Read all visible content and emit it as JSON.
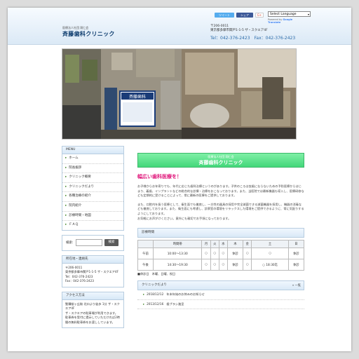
{
  "header": {
    "tagline": "医療法人社団 翔仁会",
    "title": "斉藤歯科クリニック",
    "social": {
      "twitter": "ツイート",
      "facebook": "シェア",
      "gplus": "G+"
    },
    "language": {
      "selected": "Select Language",
      "powered_prefix": "Powered by",
      "powered_brand": "Google Translate"
    },
    "postal": "〒206-0011",
    "address": "東京都多摩市関戸1-1-5 ザ・スクエア4F",
    "tel_line": "Tel：042-376-2423　Fax：042-376-2423"
  },
  "sidebar": {
    "menu_title": "MENU",
    "menu_items": [
      "ホーム",
      "院長挨拶",
      "クリニック概要",
      "クリニックだより",
      "各種治療の紹介",
      "院内紹介",
      "診療時間・地図",
      "ＦＡＱ"
    ],
    "search_label": "検索:",
    "search_button": "検索",
    "location_title": "所在地・連絡先",
    "location_lines": [
      "〒206-0011",
      "東京都多摩市関戸1-1-5 ザ・スクエア4F",
      "Tel：042-376-2423",
      "Fax：042-376-2423"
    ],
    "access_title": "アクセス方法",
    "access_lines": [
      "聖蹟桜ヶ丘駅 北口より徒歩 1分 ザ・スクエア4F",
      "ザ・スクエアの駐車場が利用できます。",
      "駐車券を受付に提示していただければ2時間の無料駐車券をお渡ししています。"
    ]
  },
  "main": {
    "banner_small": "医療法人社団 翔仁会",
    "banner_large": "斉藤歯科クリニック",
    "lead": "幅広い歯科医療を！",
    "para1": "お子様からお年寄りでも、年代に応じた歯科治療というのがあります。子供のころは虫歯にならないための予防医療からはじまり、義歯、インプラントなどの総合的な診療・治療をおこなっております。また、当医院では最新機器も導入し、医療研修なども定期的に受けることによって、常に最新の医療をご提供しております。",
    "para2": "また、口腔内を扱う医療として、衛生面でも徹底し、一方性の器具の採用や完全滅菌できる滅菌機器を採用し、機器の消毒なども徹底しております。また、衛生面にも考慮し、診察室の環境をリラックスした環境をご提供できるように、常に気配りするようにしております。",
    "para3": "お気軽にお声がけください。意外にも親切でお手頃になっております。",
    "hours_title": "診療時間",
    "hours_head": [
      "時間帯",
      "月",
      "火",
      "水",
      "木",
      "金",
      "土",
      "日"
    ],
    "hours_rows": [
      [
        "午前",
        "10:00〜13:30",
        "○",
        "○",
        "○",
        "休診",
        "○",
        "○",
        "休診"
      ],
      [
        "午後",
        "14:30〜19:30",
        "○",
        "○",
        "○",
        "休診",
        "○",
        "○ 18:30迄",
        "休診"
      ]
    ],
    "hours_note": "■休診日　木曜、日曜、祝日",
    "news_title": "クリニックだより",
    "news_more": "» 一覧",
    "news_items": [
      "2018/12/12　年末年始のお休みのお知らせ",
      "2013/12/16　歯ブラシ進呈"
    ]
  }
}
